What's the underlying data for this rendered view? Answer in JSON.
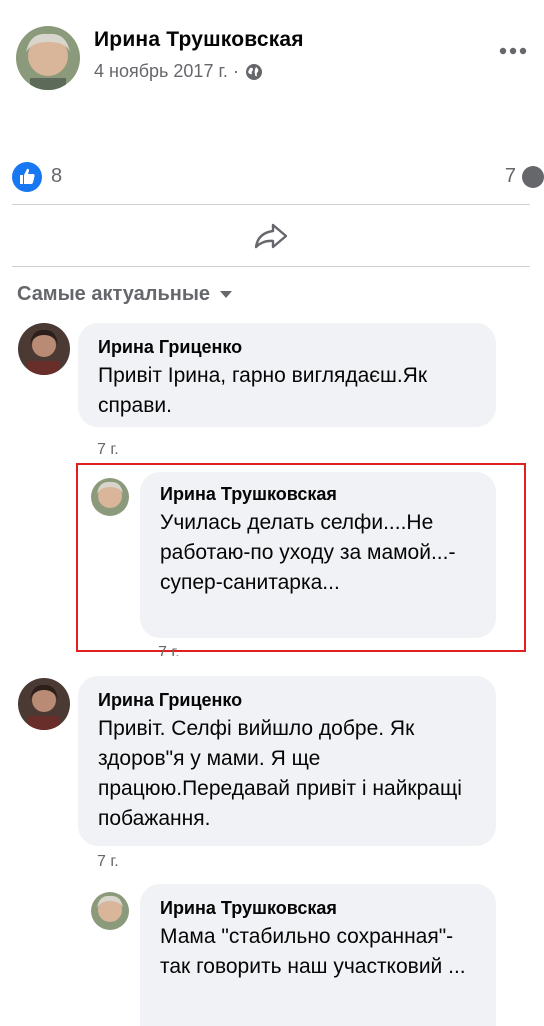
{
  "post": {
    "author": "Ирина Трушковская",
    "date": "4 ноябрь 2017 г. ·",
    "privacy_icon": "globe-icon",
    "more_icon": "more-horizontal-icon"
  },
  "reactions": {
    "like_count": "8",
    "comment_count": "7"
  },
  "sort": {
    "label": "Самые актуальные"
  },
  "comments": [
    {
      "name": "Ирина Гриценко",
      "text": "Привіт Ірина, гарно виглядаєш.Як справи.",
      "time": "7 г."
    },
    {
      "name": "Ирина Трушковская",
      "text": "Училась делать селфи....Не работаю-по уходу за мамой...-супер-санитарка...",
      "time": "7 г."
    },
    {
      "name": "Ирина Гриценко",
      "text": "Привіт. Селфі вийшло добре. Як здоров\"я у мами. Я ще працюю.Передавай привіт і найкращі побажання.",
      "time": "7 г."
    },
    {
      "name": "Ирина Трушковская",
      "text": "Мама \"стабильно сохранная\"-так говорить наш участковий ..."
    }
  ],
  "colors": {
    "like_blue": "#1877f2",
    "bubble_bg": "#f0f2f5",
    "highlight_red": "#e02020",
    "secondary_text": "#65676b"
  }
}
